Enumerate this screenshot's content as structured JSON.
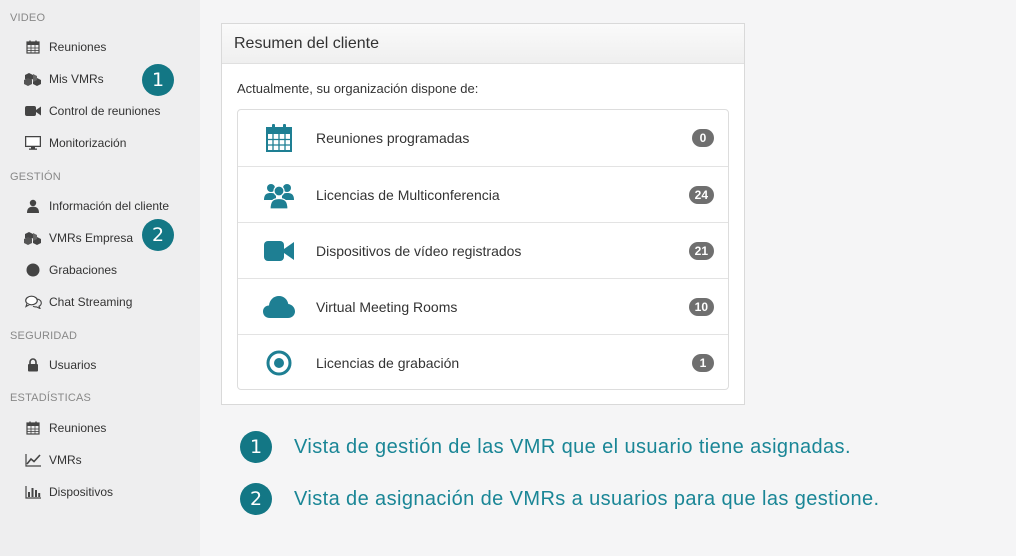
{
  "sidebar": {
    "sections": [
      {
        "title": "VIDEO",
        "items": [
          {
            "label": "Reuniones",
            "icon": "calendar-icon"
          },
          {
            "label": "Mis VMRs",
            "icon": "cubes-icon"
          },
          {
            "label": "Control de reuniones",
            "icon": "video-camera-icon"
          },
          {
            "label": "Monitorización",
            "icon": "monitor-icon"
          }
        ]
      },
      {
        "title": "GESTIÓN",
        "items": [
          {
            "label": "Información del cliente",
            "icon": "user-icon"
          },
          {
            "label": "VMRs Empresa",
            "icon": "cubes-icon"
          },
          {
            "label": "Grabaciones",
            "icon": "circle-icon"
          },
          {
            "label": "Chat Streaming",
            "icon": "chat-bubbles-icon"
          }
        ]
      },
      {
        "title": "SEGURIDAD",
        "items": [
          {
            "label": "Usuarios",
            "icon": "lock-icon"
          }
        ]
      },
      {
        "title": "ESTADÍSTICAS",
        "items": [
          {
            "label": "Reuniones",
            "icon": "calendar-icon"
          },
          {
            "label": "VMRs",
            "icon": "line-chart-icon"
          },
          {
            "label": "Dispositivos",
            "icon": "bar-chart-icon"
          }
        ]
      }
    ]
  },
  "panel": {
    "title": "Resumen del cliente",
    "intro": "Actualmente, su organización dispone de:",
    "rows": [
      {
        "label": "Reuniones programadas",
        "count": "0",
        "icon": "calendar-icon"
      },
      {
        "label": "Licencias de Multiconferencia",
        "count": "24",
        "icon": "users-icon"
      },
      {
        "label": "Dispositivos de vídeo registrados",
        "count": "21",
        "icon": "video-camera-icon"
      },
      {
        "label": "Virtual Meeting Rooms",
        "count": "10",
        "icon": "cloud-icon"
      },
      {
        "label": "Licencias de grabación",
        "count": "1",
        "icon": "record-icon"
      }
    ]
  },
  "annotations": {
    "badges": [
      "1",
      "2"
    ],
    "legend": [
      {
        "number": "1",
        "text": "Vista de gestión de las VMR que el usuario tiene asignadas."
      },
      {
        "number": "2",
        "text": "Vista de asignación de VMRs a usuarios para que las gestione."
      }
    ]
  },
  "colors": {
    "accent": "#137785",
    "legend_text": "#1a8696",
    "icon_teal": "#1e7f93",
    "badge_gray": "#6f6f6f",
    "sidebar_bg": "#eeeeef"
  }
}
